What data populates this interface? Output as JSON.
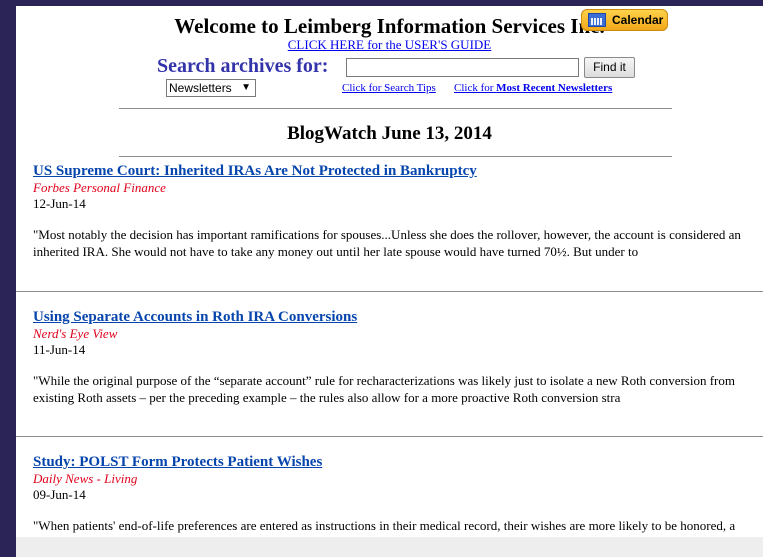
{
  "header": {
    "title": "Welcome to Leimberg Information Services Inc.",
    "guide_link": "CLICK HERE for the USER'S GUIDE",
    "calendar_label": "Calendar"
  },
  "search": {
    "label": "Search archives for:",
    "value": "",
    "button": "Find it",
    "selected_option": "Newsletters",
    "tips_link": "Click for Search Tips",
    "recent_prefix": "Click for",
    "recent_bold": "Most Recent Newsletters"
  },
  "blog": {
    "title": "BlogWatch   June 13, 2014"
  },
  "articles": [
    {
      "title": "US Supreme Court: Inherited IRAs Are Not Protected in Bankruptcy",
      "source": "Forbes Personal Finance",
      "date": "12-Jun-14",
      "excerpt": "\"Most notably the decision has important ramifications for spouses...Unless she does the rollover, however, the account is considered an inherited IRA. She would not have to take any money out until her late spouse would have turned 70½. But under to"
    },
    {
      "title": "Using Separate Accounts in Roth IRA Conversions",
      "source": "Nerd's Eye View",
      "date": "11-Jun-14",
      "excerpt": "\"While the original purpose of the “separate account” rule for recharacterizations was likely just to isolate a new Roth conversion from existing Roth assets – per the preceding example – the rules also allow for a more proactive Roth conversion stra"
    },
    {
      "title": "Study: POLST Form Protects Patient Wishes",
      "source": "Daily News - Living",
      "date": "09-Jun-14",
      "excerpt": "\"When patients' end-of-life preferences are entered as instructions in their medical record, their wishes are more likely to be honored, a new study suggests.\""
    }
  ],
  "colors": {
    "frame": "#2b2456",
    "link": "#0645ad",
    "source": "#e0001a",
    "search_label": "#3333aa"
  }
}
